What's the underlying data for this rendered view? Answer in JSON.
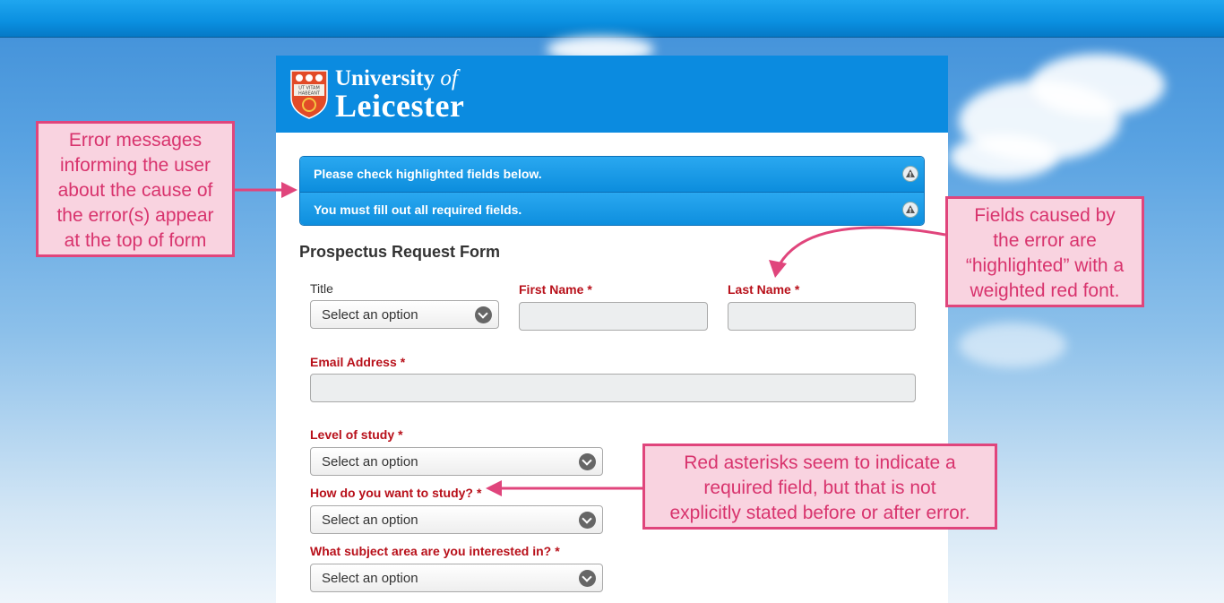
{
  "logo": {
    "line1": "University",
    "line1_italic": "of",
    "line2": "Leicester",
    "motto_line1": "UT VITAM",
    "motto_line2": "HABEANT"
  },
  "alerts": [
    "Please check highlighted fields below.",
    "You must fill out all required fields."
  ],
  "form": {
    "title": "Prospectus Request Form",
    "title_field": {
      "label": "Title",
      "value": "Select an option"
    },
    "first_name": {
      "label": "First Name",
      "value": ""
    },
    "last_name": {
      "label": "Last Name",
      "value": ""
    },
    "email": {
      "label": "Email Address",
      "value": ""
    },
    "level": {
      "label": "Level of study",
      "value": "Select an option"
    },
    "how": {
      "label": "How do you want to study?",
      "value": "Select an option"
    },
    "subject": {
      "label": "What subject area are you interested in?",
      "value": "Select an option"
    },
    "required_marker": "*"
  },
  "annotations": {
    "left": [
      "Error messages",
      "informing the user",
      "about the cause of",
      "the error(s) appear",
      "at the top of form"
    ],
    "right": [
      "Fields caused by",
      "the error are",
      "“highlighted” with a",
      "weighted red font."
    ],
    "bottom": [
      "Red asterisks seem to indicate a",
      "required field, but that is not",
      "explicitly stated before or after error."
    ]
  },
  "colors": {
    "accent": "#0b8be0",
    "required_red": "#b8101a",
    "note_border": "#e0457c",
    "note_fill": "#f9d3e0"
  }
}
